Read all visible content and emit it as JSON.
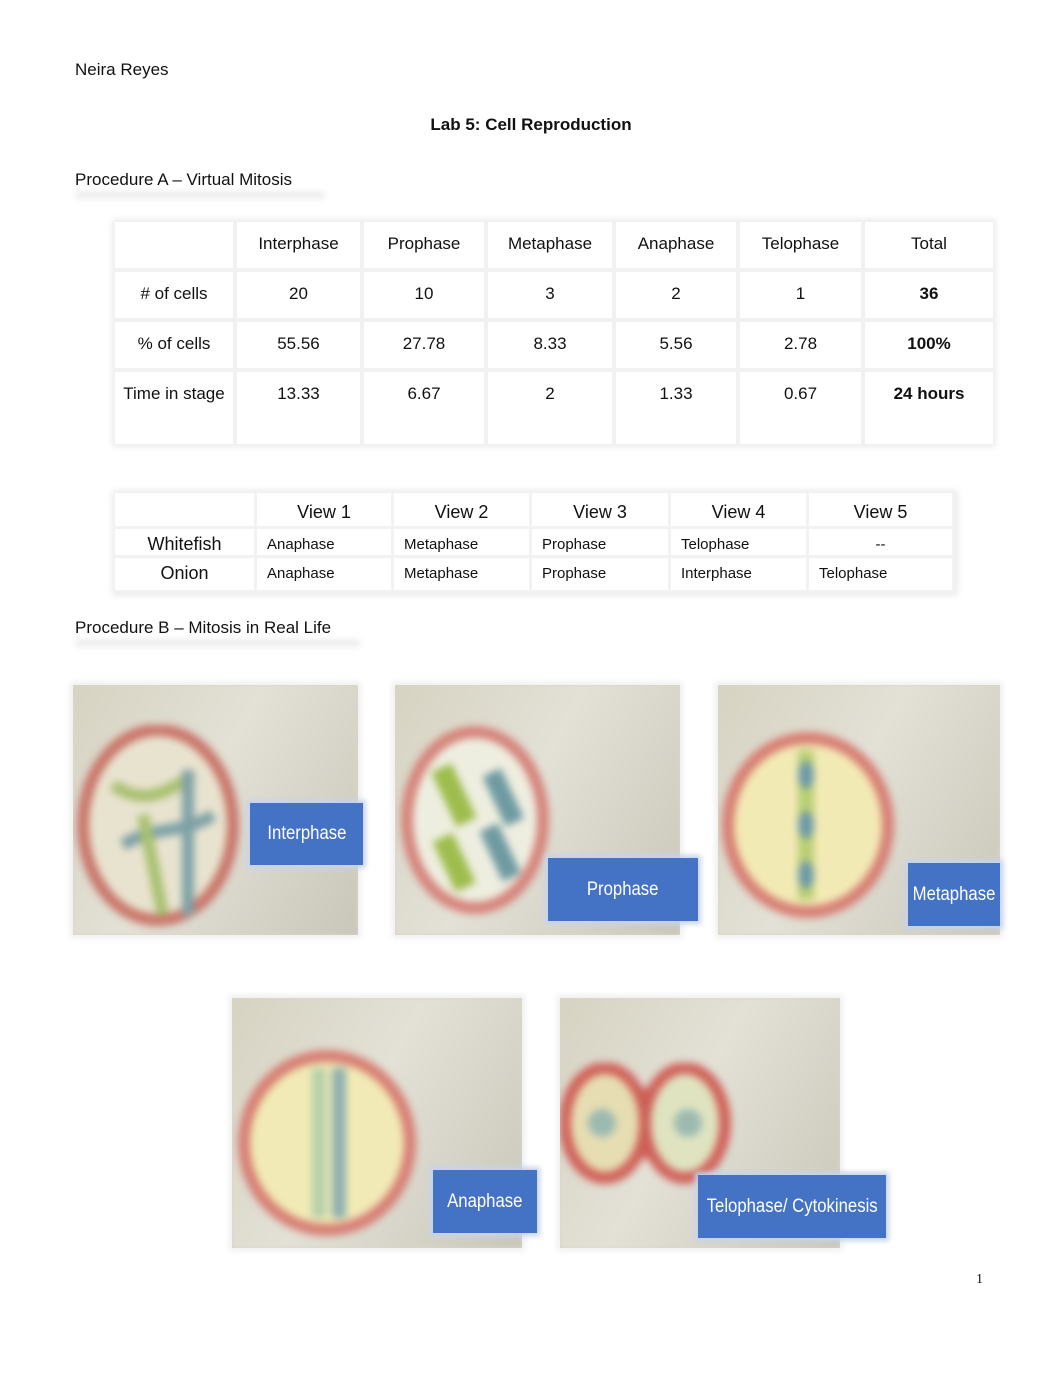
{
  "header": {
    "author": "Neira Reyes",
    "title": "Lab 5: Cell Reproduction"
  },
  "procedure_a": {
    "heading": "Procedure A – Virtual Mitosis",
    "table1": {
      "columns": [
        "",
        "Interphase",
        "Prophase",
        "Metaphase",
        "Anaphase",
        "Telophase",
        "Total"
      ],
      "rows": [
        {
          "label": "# of cells",
          "values": [
            "20",
            "10",
            "3",
            "2",
            "1"
          ],
          "total": "36"
        },
        {
          "label": "% of cells",
          "values": [
            "55.56",
            "27.78",
            "8.33",
            "5.56",
            "2.78"
          ],
          "total": "100%"
        },
        {
          "label": "Time in stage",
          "values": [
            "13.33",
            "6.67",
            "2",
            "1.33",
            "0.67"
          ],
          "total": "24 hours"
        }
      ]
    },
    "table2": {
      "columns": [
        "",
        "View 1",
        "View 2",
        "View 3",
        "View 4",
        "View 5"
      ],
      "rows": [
        {
          "label": "Whitefish",
          "values": [
            "Anaphase",
            "Metaphase",
            "Prophase",
            "Telophase",
            "--"
          ]
        },
        {
          "label": "Onion",
          "values": [
            "Anaphase",
            "Metaphase",
            "Prophase",
            "Interphase",
            "Telophase"
          ]
        }
      ]
    }
  },
  "procedure_b": {
    "heading": "Procedure B – Mitosis in Real Life",
    "photos": [
      {
        "label": "Interphase"
      },
      {
        "label": "Prophase"
      },
      {
        "label": "Metaphase"
      },
      {
        "label": "Anaphase"
      },
      {
        "label": "Telophase/ Cytokinesis"
      }
    ],
    "label_color": "#4472c4"
  },
  "footer": {
    "page_number": "1"
  }
}
